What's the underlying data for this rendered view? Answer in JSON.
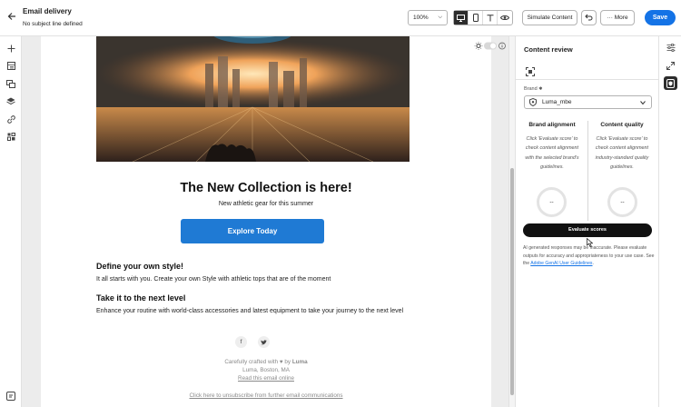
{
  "header": {
    "title": "Email delivery",
    "subtitle": "No subject line defined",
    "zoom": "100%",
    "simulate_label": "Simulate Content",
    "more_label": "More",
    "save_label": "Save"
  },
  "left_rail": {
    "icons": [
      "plus-icon",
      "structure-icon",
      "assets-icon",
      "layers-icon",
      "link-icon",
      "fragments-icon",
      "help-icon"
    ]
  },
  "email": {
    "headline": "The New Collection is here!",
    "subhead": "New athletic gear for this summer",
    "cta_label": "Explore Today",
    "section1_title": "Define your own style!",
    "section1_text": "It all starts with you. Create your own Style with athletic tops that are of the moment",
    "section2_title": "Take it to the next level",
    "section2_text": "Enhance your routine with world-class accessories and latest equipment to take your journey to the next level",
    "social": [
      "f",
      "twitter-icon"
    ],
    "footer_line1_a": "Carefully crafted with",
    "footer_line1_b": "by",
    "footer_brand": "Luma",
    "footer_line2": "Luma, Boston, MA",
    "footer_link": "Read this email online",
    "unsubscribe": "Click here to unsubscribe from further email communications"
  },
  "panel": {
    "title": "Content review",
    "brand_label": "Brand",
    "brand_value": "Luma_mbe",
    "brand_alignment_title": "Brand alignment",
    "brand_alignment_text": "Click 'Evaluate score' to check content alignment with the selected brand's guidelines.",
    "content_quality_title": "Content quality",
    "content_quality_text": "Click 'Evaluate score' to check content alignment industry-standard quality guidelines.",
    "brand_score": "--",
    "quality_score": "--",
    "evaluate_label": "Evaluate scores",
    "disclaimer": "AI generated responses may be inaccurate. Please evaluate outputs for accuracy and appropriateness to your use case. See the",
    "disclaimer_link": "Adobe GenAI User Guidelines",
    "disclaimer_end": "."
  },
  "colors": {
    "accent": "#1473e6",
    "cta": "#1f7ad4",
    "dark": "#2c2c2c"
  }
}
